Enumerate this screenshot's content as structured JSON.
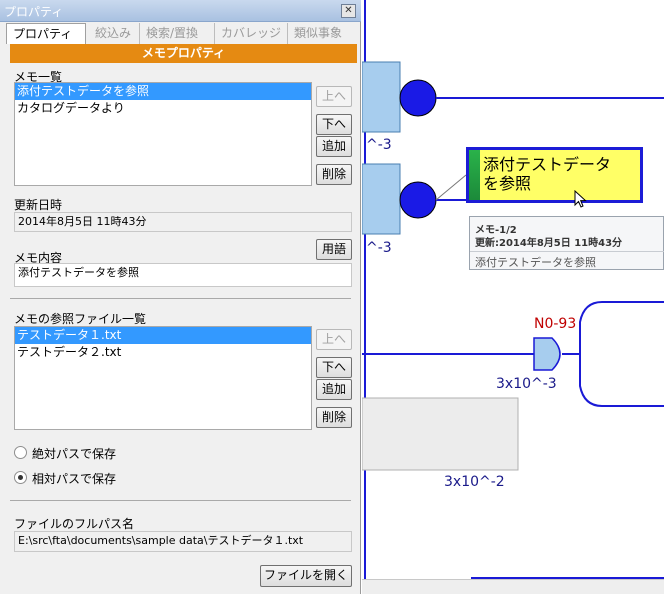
{
  "window": {
    "title": "プロパティ",
    "close_glyph": "✕"
  },
  "tabs": [
    {
      "label": "プロパティ",
      "active": true
    },
    {
      "label": "絞込み",
      "active": false
    },
    {
      "label": "検索/置換",
      "active": false
    },
    {
      "label": "カバレッジ",
      "active": false
    },
    {
      "label": "類似事象",
      "active": false
    }
  ],
  "section_header": "メモプロパティ",
  "memo_list": {
    "label": "メモ一覧",
    "items": [
      "添付テストデータを参照",
      "カタログデータより"
    ],
    "selected_index": 0,
    "buttons": {
      "up": "上へ",
      "down": "下へ",
      "add": "追加",
      "delete": "削除"
    }
  },
  "updated": {
    "label": "更新日時",
    "value": "2014年8月5日 11時43分"
  },
  "memo_content": {
    "label": "メモ内容",
    "term_button": "用語",
    "value": "添付テストデータを参照"
  },
  "ref_files": {
    "label": "メモの参照ファイル一覧",
    "items": [
      "テストデータ１.txt",
      "テストデータ２.txt"
    ],
    "selected_index": 0,
    "buttons": {
      "up": "上へ",
      "down": "下へ",
      "add": "追加",
      "delete": "削除"
    }
  },
  "save_mode": {
    "absolute_label": "絶対パスで保存",
    "relative_label": "相対パスで保存",
    "selected": "relative"
  },
  "full_path": {
    "label": "ファイルのフルパス名",
    "value": "E:\\src\\fta\\documents\\sample data\\テストデータ１.txt",
    "open_button": "ファイルを開く"
  },
  "diagram": {
    "prob_label_1": "^-3",
    "prob_label_2": "^-3",
    "gate_id": "N0-93",
    "gate_prob": "3x10^-3",
    "event_prob": "3x10^-2",
    "callout_line1": "添付テストデータ",
    "callout_line2": "を参照",
    "tooltip": {
      "line1": "メモ-1/2",
      "line2": "更新:2014年8月5日 11時43分",
      "line3": "添付テストデータを参照"
    },
    "colors": {
      "line": "#1a1ad6",
      "event_fill": "#a7cdee",
      "gate_fill": "#a7cdee",
      "callout_fill": "#ffff66",
      "memo_bar": "#2ab24a",
      "header_orange": "#e58a12"
    }
  }
}
